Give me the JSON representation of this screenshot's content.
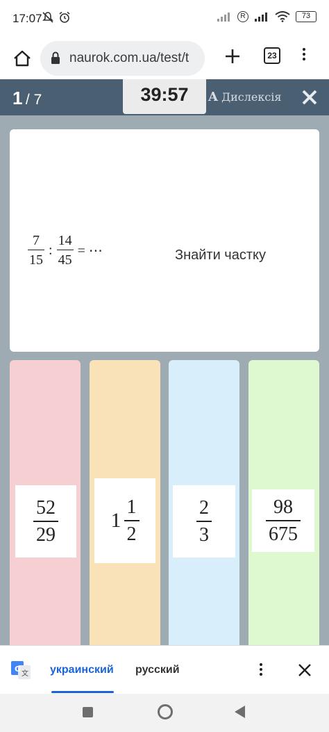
{
  "status_bar": {
    "time": "17:07",
    "battery": "73",
    "icons": [
      "mute-icon",
      "alarm-icon",
      "signal-icon",
      "r-badge-icon",
      "signal-icon",
      "wifi-icon",
      "battery-icon"
    ]
  },
  "browser": {
    "url": "naurok.com.ua/test/t",
    "tab_count": "23"
  },
  "quiz": {
    "current": "1",
    "total": "/ 7",
    "timer": "39:57",
    "dyslexia_a": "A",
    "dyslexia_label": "Дислексія",
    "question": {
      "frac1_num": "7",
      "frac1_den": "15",
      "op": ":",
      "frac2_num": "14",
      "frac2_den": "45",
      "tail": "= ⋯",
      "text": "Знайти частку"
    },
    "answers": [
      {
        "num": "52",
        "den": "29",
        "whole": "",
        "color": "#f6cfd2"
      },
      {
        "num": "1",
        "den": "2",
        "whole": "1",
        "color": "#f9e1b8"
      },
      {
        "num": "2",
        "den": "3",
        "whole": "",
        "color": "#d8eefb"
      },
      {
        "num": "98",
        "den": "675",
        "whole": "",
        "color": "#def9d0"
      }
    ]
  },
  "translate": {
    "lang_active": "украинский",
    "lang_other": "русский"
  }
}
